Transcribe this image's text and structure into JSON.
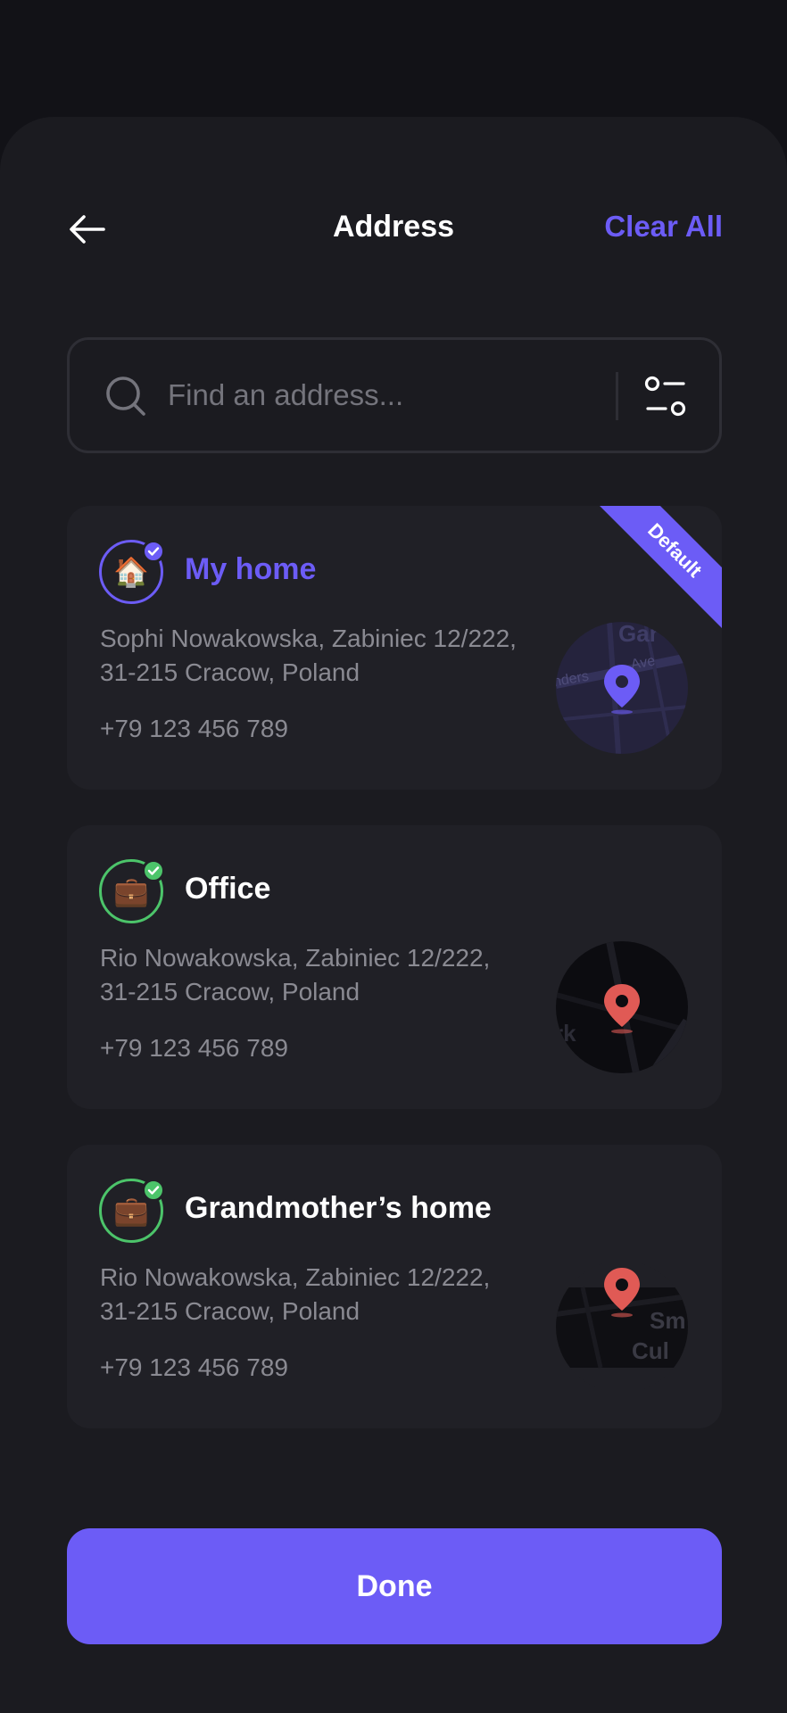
{
  "header": {
    "title": "Address",
    "clear_all_label": "Clear All"
  },
  "search": {
    "placeholder": "Find an address..."
  },
  "addresses": [
    {
      "title": "My home",
      "icon": "house-emoji",
      "address_line1": "Sophi Nowakowska, Zabiniec 12/222,",
      "address_line2": "31-215 Cracow, Poland",
      "phone": "+79 123 456 789",
      "badge": "Default",
      "accent_color": "#6c5cf6",
      "map_labels": [
        "Gar",
        "Ave",
        "nders"
      ]
    },
    {
      "title": "Office",
      "icon": "briefcase-emoji",
      "address_line1": "Rio Nowakowska, Zabiniec 12/222,",
      "address_line2": "31-215 Cracow, Poland",
      "phone": "+79 123 456 789",
      "accent_color": "#4cc46a",
      "map_labels": [
        "rk"
      ]
    },
    {
      "title": "Grandmother’s home",
      "icon": "briefcase-emoji",
      "address_line1": "Rio Nowakowska, Zabiniec 12/222,",
      "address_line2": "31-215 Cracow, Poland",
      "phone": "+79 123 456 789",
      "accent_color": "#4cc46a",
      "map_labels": [
        "Sm",
        "Cul"
      ]
    }
  ],
  "done_label": "Done",
  "colors": {
    "accent": "#6c5cf6",
    "success": "#4cc46a",
    "pin_red": "#e05a55",
    "background": "#121217",
    "card": "#202026"
  }
}
